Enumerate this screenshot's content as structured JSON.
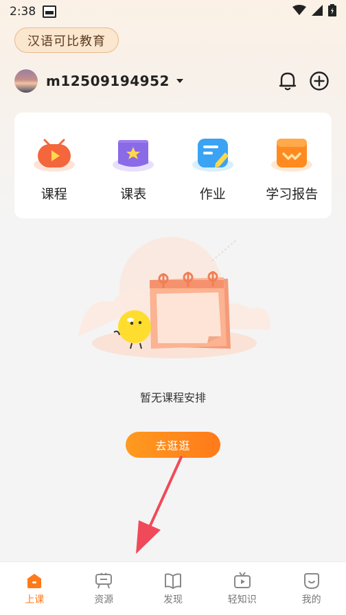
{
  "status": {
    "time": "2:38"
  },
  "header": {
    "school_name": "汉语可比教育",
    "username": "m12509194952"
  },
  "menu": {
    "items": [
      {
        "label": "课程",
        "icon": "course-icon"
      },
      {
        "label": "课表",
        "icon": "timetable-icon"
      },
      {
        "label": "作业",
        "icon": "homework-icon"
      },
      {
        "label": "学习报告",
        "icon": "report-icon"
      }
    ]
  },
  "empty_state": {
    "text": "暂无课程安排",
    "button_label": "去逛逛"
  },
  "tabs": [
    {
      "label": "上课",
      "icon": "home-icon",
      "active": true
    },
    {
      "label": "资源",
      "icon": "resource-icon",
      "active": false
    },
    {
      "label": "发现",
      "icon": "book-icon",
      "active": false
    },
    {
      "label": "轻知识",
      "icon": "tv-icon",
      "active": false
    },
    {
      "label": "我的",
      "icon": "profile-icon",
      "active": false
    }
  ],
  "colors": {
    "accent": "#ff7a1a",
    "pill_bg": "#fbe6cf",
    "arrow": "#f04a5a"
  }
}
